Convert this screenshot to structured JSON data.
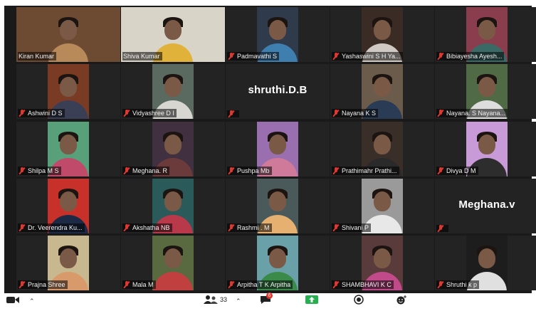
{
  "colors": {
    "active_speaker": "#e6e24a",
    "muted_icon": "#e0372e",
    "gallery_bg": "#1a1a1a"
  },
  "participants": [
    {
      "label": "Kiran Kumar",
      "muted": false,
      "active": true,
      "video": true
    },
    {
      "label": "Shiva Kumar",
      "muted": false,
      "video": true
    },
    {
      "label": "Padmavathi S",
      "muted": true,
      "video": true
    },
    {
      "label": "Yashaswini S H Ya...",
      "muted": true,
      "video": true
    },
    {
      "label": "Bibiayesha Ayesh...",
      "muted": true,
      "video": true
    },
    {
      "label": "Ashwini D S",
      "muted": true,
      "video": true
    },
    {
      "label": "Vidyashree D I",
      "muted": true,
      "video": true
    },
    {
      "label": "",
      "display_name": "shruthi.D.B",
      "muted": true,
      "video": false
    },
    {
      "label": "Nayana K S",
      "muted": true,
      "video": true
    },
    {
      "label": "Nayana. S Nayana...",
      "muted": true,
      "video": true
    },
    {
      "label": "Shilpa M S",
      "muted": true,
      "video": true
    },
    {
      "label": "Meghana. R",
      "muted": true,
      "video": true
    },
    {
      "label": "Pushpa Mb",
      "muted": true,
      "video": true
    },
    {
      "label": "Prathimahr Prathi...",
      "muted": true,
      "video": true
    },
    {
      "label": "Divya D M",
      "muted": true,
      "video": true
    },
    {
      "label": "Dr. Veerendra Ku...",
      "muted": true,
      "video": true
    },
    {
      "label": "Akshatha NB",
      "muted": true,
      "video": true
    },
    {
      "label": "Rashmi . M",
      "muted": true,
      "video": true
    },
    {
      "label": "Shivani P",
      "muted": true,
      "video": true
    },
    {
      "label": "",
      "display_name": "Meghana.v",
      "muted": true,
      "video": false
    },
    {
      "label": "Prajna Shree",
      "muted": true,
      "video": true
    },
    {
      "label": "Mala M",
      "muted": true,
      "video": true
    },
    {
      "label": "Arpitha T K Arpitha",
      "muted": true,
      "video": true
    },
    {
      "label": "SHAMBHAVI K C",
      "muted": true,
      "video": true
    },
    {
      "label": "Shruthi k p",
      "muted": true,
      "video": true
    }
  ],
  "toolbar": {
    "participants_count": "33",
    "chat_badge": "6",
    "share_color": "#22b14c"
  }
}
